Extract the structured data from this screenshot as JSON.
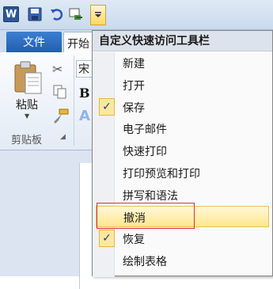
{
  "qat": {
    "app_icon_letter": "W"
  },
  "tabs": {
    "file": "文件",
    "home": "开始"
  },
  "ribbon": {
    "paste_label": "粘贴",
    "clipboard_group": "剪贴板",
    "font_name": "宋",
    "bold": "B",
    "text_effect": "A"
  },
  "menu": {
    "title": "自定义快速访问工具栏",
    "items": [
      {
        "label": "新建",
        "checked": false
      },
      {
        "label": "打开",
        "checked": false
      },
      {
        "label": "保存",
        "checked": true
      },
      {
        "label": "电子邮件",
        "checked": false
      },
      {
        "label": "快速打印",
        "checked": false
      },
      {
        "label": "打印预览和打印",
        "checked": false
      },
      {
        "label": "拼写和语法",
        "checked": false
      },
      {
        "label": "撤消",
        "checked": false,
        "highlighted": true
      },
      {
        "label": "恢复",
        "checked": true
      },
      {
        "label": "绘制表格",
        "checked": false
      }
    ],
    "check_glyph": "✓"
  },
  "colors": {
    "accent": "#245eb0",
    "highlight": "#ffe68d",
    "callout_border": "#d33636"
  }
}
